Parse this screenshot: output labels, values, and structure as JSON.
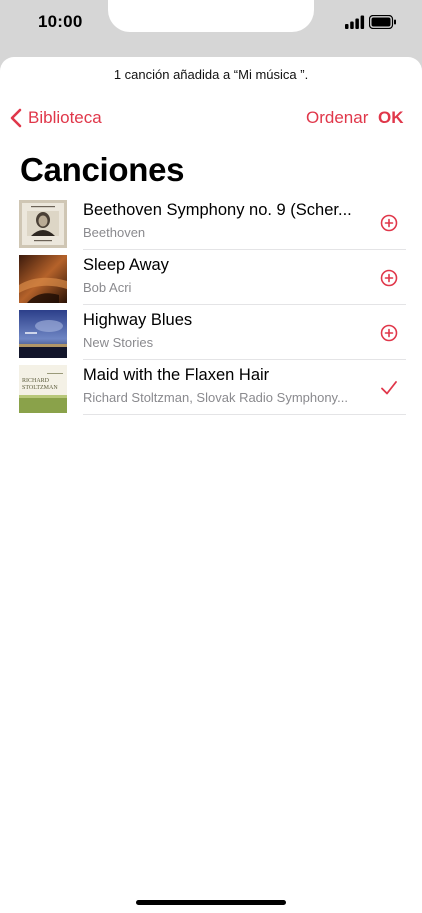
{
  "status_bar": {
    "time": "10:00"
  },
  "notice": "1 canción añadida a “Mi música ”.",
  "nav": {
    "back_label": "Biblioteca",
    "order_label": "Ordenar",
    "ok_label": "OK"
  },
  "title": "Canciones",
  "songs": [
    {
      "title": "Beethoven Symphony no. 9 (Scher...",
      "artist": "Beethoven",
      "state": "add",
      "artwork": "beethoven-portrait-art"
    },
    {
      "title": "Sleep Away",
      "artist": "Bob Acri",
      "state": "add",
      "artwork": "brown-abstract-art"
    },
    {
      "title": "Highway Blues",
      "artist": "New Stories",
      "state": "add",
      "artwork": "blue-sky-art"
    },
    {
      "title": "Maid with the Flaxen Hair",
      "artist": "Richard Stoltzman, Slovak Radio Symphony...",
      "state": "added",
      "artwork": "stoltzman-cover-art",
      "art_text_line1": "RICHARD",
      "art_text_line2": "STOLTZMAN"
    }
  ],
  "colors": {
    "accent": "#e0374a",
    "secondary_text": "#8a8a8e",
    "separator": "#e4e4e6",
    "background": "#d6d6d6"
  }
}
